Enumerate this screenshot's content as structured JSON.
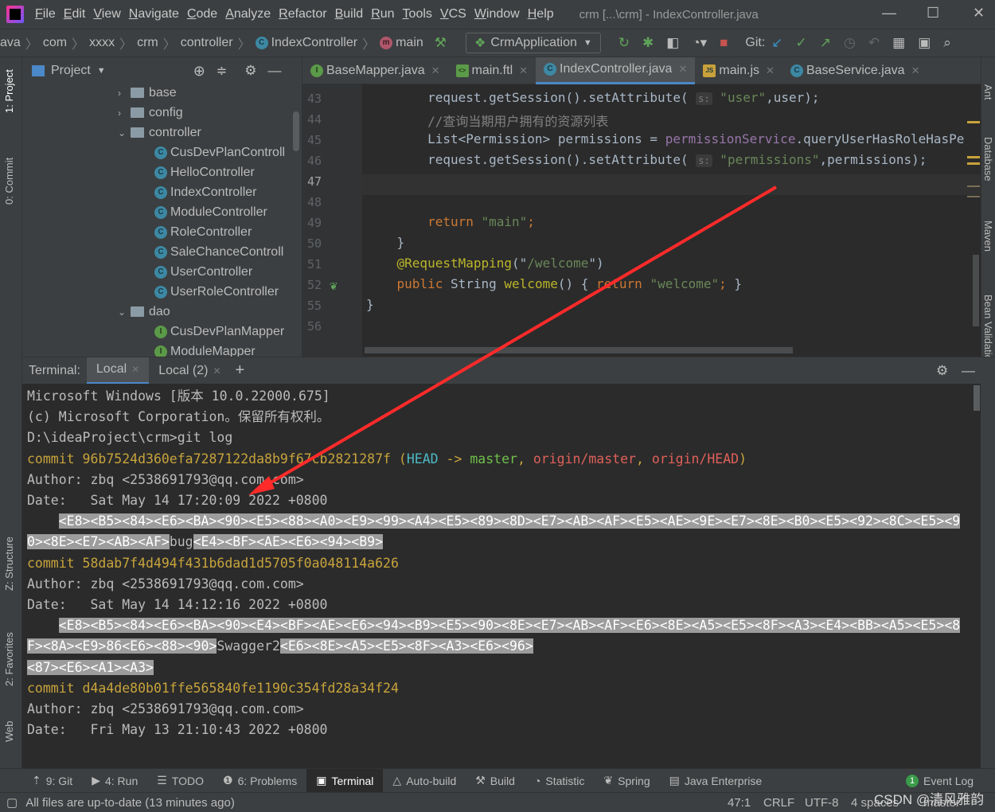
{
  "window": {
    "title": "crm [...\\crm] - IndexController.java",
    "minimize": "—",
    "maximize": "☐",
    "close": "✕"
  },
  "menu": [
    "File",
    "Edit",
    "View",
    "Navigate",
    "Code",
    "Analyze",
    "Refactor",
    "Build",
    "Run",
    "Tools",
    "VCS",
    "Window",
    "Help"
  ],
  "breadcrumb": [
    "ava",
    "com",
    "xxxx",
    "crm",
    "controller",
    "IndexController",
    "main"
  ],
  "toolbar": {
    "run_config": "CrmApplication",
    "git_label": "Git:"
  },
  "left_strip": [
    "1: Project",
    "0: Commit",
    "Z: Structure",
    "2: Favorites",
    "Web"
  ],
  "right_strip": [
    "Ant",
    "Database",
    "Maven",
    "Bean Validation"
  ],
  "project": {
    "title": "Project",
    "tree": [
      {
        "label": "base",
        "type": "folder",
        "expanded": false,
        "depth": 1
      },
      {
        "label": "config",
        "type": "folder",
        "expanded": false,
        "depth": 1
      },
      {
        "label": "controller",
        "type": "folder",
        "expanded": true,
        "depth": 1
      },
      {
        "label": "CusDevPlanControll",
        "type": "class",
        "depth": 2
      },
      {
        "label": "HelloController",
        "type": "class",
        "depth": 2
      },
      {
        "label": "IndexController",
        "type": "class",
        "depth": 2
      },
      {
        "label": "ModuleController",
        "type": "class",
        "depth": 2
      },
      {
        "label": "RoleController",
        "type": "class",
        "depth": 2
      },
      {
        "label": "SaleChanceControll",
        "type": "class",
        "depth": 2
      },
      {
        "label": "UserController",
        "type": "class",
        "depth": 2
      },
      {
        "label": "UserRoleController",
        "type": "class",
        "depth": 2
      },
      {
        "label": "dao",
        "type": "folder",
        "expanded": true,
        "depth": 1
      },
      {
        "label": "CusDevPlanMapper",
        "type": "interface",
        "depth": 2
      },
      {
        "label": "ModuleMapper",
        "type": "interface",
        "depth": 2
      }
    ]
  },
  "editor_tabs": [
    {
      "label": "BaseMapper.java",
      "icon": "interface-icon",
      "active": false
    },
    {
      "label": "main.ftl",
      "icon": "ftl-file-icon",
      "active": false
    },
    {
      "label": "IndexController.java",
      "icon": "class-icon",
      "active": true
    },
    {
      "label": "main.js",
      "icon": "js-file-icon",
      "active": false
    },
    {
      "label": "BaseService.java",
      "icon": "class-icon",
      "active": false
    }
  ],
  "inspections": {
    "warnings": "4",
    "weak_warnings": "2"
  },
  "code": [
    {
      "ln": "43",
      "segs": [
        [
          "",
          "request.getSession().setAttribute( "
        ],
        [
          "hint",
          "s:"
        ],
        [
          "str",
          " \"user\""
        ],
        [
          "",
          ",user);"
        ]
      ]
    },
    {
      "ln": "44",
      "segs": [
        [
          "cm",
          "//查询当期用户拥有的资源列表"
        ]
      ]
    },
    {
      "ln": "45",
      "segs": [
        [
          "",
          "List<Permission> permissions = "
        ],
        [
          "fld",
          "permissionService"
        ],
        [
          "",
          ".queryUserHasRoleHasPe"
        ]
      ]
    },
    {
      "ln": "46",
      "segs": [
        [
          "",
          "request.getSession().setAttribute( "
        ],
        [
          "hint",
          "s:"
        ],
        [
          "str",
          " \"permissions\""
        ],
        [
          "",
          ",permissions);"
        ]
      ]
    },
    {
      "ln": "47",
      "segs": []
    },
    {
      "ln": "48",
      "segs": []
    },
    {
      "ln": "49",
      "segs": [
        [
          "kw",
          "return "
        ],
        [
          "str",
          "\"main\""
        ],
        [
          "kw",
          ";"
        ]
      ]
    },
    {
      "ln": "50",
      "indent": "    ",
      "segs": [
        [
          "",
          "}"
        ]
      ]
    },
    {
      "ln": "51",
      "indent": "    ",
      "segs": [
        [
          "an",
          "@RequestMapping"
        ],
        [
          "",
          "(\""
        ],
        [
          "str",
          "/welcome"
        ],
        [
          "",
          "\")"
        ]
      ]
    },
    {
      "ln": "52",
      "indent": "    ",
      "segs": [
        [
          "kw",
          "public "
        ],
        [
          "",
          "String "
        ],
        [
          "an",
          "welcome"
        ],
        [
          "",
          "() { "
        ],
        [
          "kw",
          "return "
        ],
        [
          "str",
          "\"welcome\""
        ],
        [
          "kw",
          ";"
        ],
        [
          "",
          " }"
        ]
      ]
    },
    {
      "ln": "55",
      "indent": "",
      "segs": [
        [
          "",
          "}"
        ]
      ]
    },
    {
      "ln": "56",
      "indent": "",
      "segs": []
    }
  ],
  "terminal": {
    "label": "Terminal:",
    "tabs": [
      "Local",
      "Local (2)"
    ],
    "lines": [
      [
        [
          "",
          "Microsoft Windows [版本 10.0.22000.675]"
        ]
      ],
      [
        [
          "",
          "(c) Microsoft Corporation。保留所有权利。"
        ]
      ],
      [
        [
          "",
          "D:\\ideaProject\\crm>git log"
        ]
      ],
      [
        [
          "y",
          "commit 96b7524d360efa7287122da8b9f67cb2821287f "
        ],
        [
          "y",
          "("
        ],
        [
          "cy",
          "HEAD"
        ],
        [
          "y",
          " -> "
        ],
        [
          "gr",
          "master"
        ],
        [
          "y",
          ", "
        ],
        [
          "rd",
          "origin/master"
        ],
        [
          "y",
          ", "
        ],
        [
          "rd",
          "origin/HEAD"
        ],
        [
          "y",
          ")"
        ]
      ],
      [
        [
          "",
          "Author: zbq <2538691793@qq.com.com>"
        ]
      ],
      [
        [
          "",
          "Date:   Sat May 14 17:20:09 2022 +0800"
        ]
      ],
      [
        [
          "",
          "    "
        ],
        [
          "hl",
          "<E8><B5><84><E6><BA><90><E5><88><A0><E9><99><A4><E5><89><8D><E7><AB><AF><E5><AE><9E><E7><8E><B0><E5><92><8C><E5><9"
        ]
      ],
      [
        [
          "hl",
          "0><8E><E7><AB><AF>"
        ],
        [
          "",
          "bug"
        ],
        [
          "hl",
          "<E4><BF><AE><E6><94><B9>"
        ]
      ],
      [
        [
          "y",
          "commit 58dab7f4d494f431b6dad1d5705f0a048114a626"
        ]
      ],
      [
        [
          "",
          "Author: zbq <2538691793@qq.com.com>"
        ]
      ],
      [
        [
          "",
          "Date:   Sat May 14 14:12:16 2022 +0800"
        ]
      ],
      [
        [
          "",
          "    "
        ],
        [
          "hl",
          "<E8><B5><84><E6><BA><90><E4><BF><AE><E6><94><B9><E5><90><8E><E7><AB><AF><E6><8E><A5><E5><8F><A3><E4><BB><A5><E5><8"
        ]
      ],
      [
        [
          "hl",
          "F><8A><E9>86<E6><88><90>"
        ],
        [
          "",
          "Swagger2"
        ],
        [
          "hl",
          "<E6><8E><A5><E5><8F><A3><E6><96>"
        ]
      ],
      [
        [
          "hl",
          "<87><E6><A1><A3>"
        ]
      ],
      [
        [
          "y",
          "commit d4a4de80b01ffe565840fe1190c354fd28a34f24"
        ]
      ],
      [
        [
          "",
          "Author: zbq <2538691793@qq.com.com>"
        ]
      ],
      [
        [
          "",
          "Date:   Fri May 13 21:10:43 2022 +0800"
        ]
      ]
    ]
  },
  "tool_windows": [
    {
      "label": "9: Git",
      "icon": "git-icon"
    },
    {
      "label": "4: Run",
      "icon": "run-icon"
    },
    {
      "label": "TODO",
      "icon": "todo-icon"
    },
    {
      "label": "6: Problems",
      "icon": "problems-icon"
    },
    {
      "label": "Terminal",
      "icon": "terminal-icon",
      "active": true
    },
    {
      "label": "Auto-build",
      "icon": "auto-build-icon"
    },
    {
      "label": "Build",
      "icon": "build-icon"
    },
    {
      "label": "Statistic",
      "icon": "statistic-icon"
    },
    {
      "label": "Spring",
      "icon": "spring-icon"
    },
    {
      "label": "Java Enterprise",
      "icon": "java-enterprise-icon"
    }
  ],
  "event_log": {
    "label": "Event Log",
    "count": "1"
  },
  "status": {
    "message": "All files are up-to-date (13 minutes ago)",
    "position": "47:1",
    "line_sep": "CRLF",
    "encoding": "UTF-8",
    "indent": "4 spaces",
    "branch": "master",
    "watermark": "CSDN @清风雅韵"
  },
  "colors": {
    "accent": "#4a88c7",
    "annotation_arrow": "#ff2a2a",
    "editor_bg": "#2b2b2b"
  }
}
